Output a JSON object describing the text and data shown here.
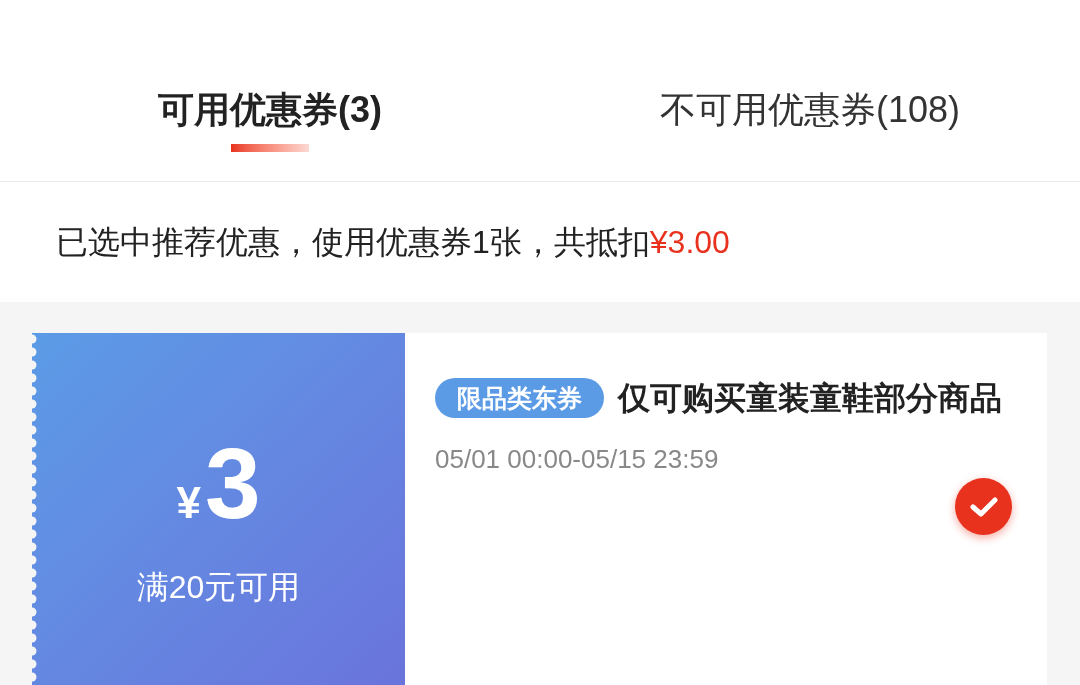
{
  "tabs": [
    {
      "label": "可用优惠券(3)",
      "selected": true
    },
    {
      "label": "不可用优惠券(108)",
      "selected": false
    }
  ],
  "summary": {
    "text": "已选中推荐优惠，使用优惠券1张，共抵扣",
    "amount": "¥3.00"
  },
  "coupons": [
    {
      "currency": "¥",
      "amount": "3",
      "condition": "满20元可用",
      "tag": "限品类东券",
      "title": "仅可购买童装童鞋部分商品",
      "validity": "05/01 00:00-05/15 23:59",
      "selected": true
    }
  ]
}
